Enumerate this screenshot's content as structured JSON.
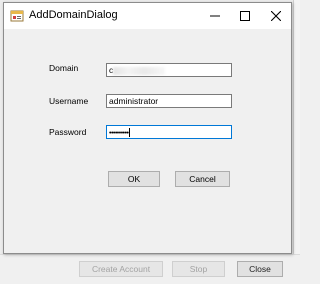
{
  "dialog": {
    "title": "AddDomainDialog",
    "icons": {
      "app": "app-form-icon",
      "minimize": "minimize-icon",
      "maximize": "maximize-icon",
      "close": "close-icon"
    }
  },
  "form": {
    "domain_label": "Domain",
    "domain_value": "c",
    "username_label": "Username",
    "username_value": "administrator",
    "password_label": "Password",
    "password_value": "••••••••••"
  },
  "buttons": {
    "ok": "OK",
    "cancel": "Cancel"
  },
  "background_window": {
    "create_account": "Create Account",
    "stop": "Stop",
    "close": "Close"
  },
  "colors": {
    "focus_border": "#0078d7",
    "dialog_bg": "#f0f0f0"
  }
}
